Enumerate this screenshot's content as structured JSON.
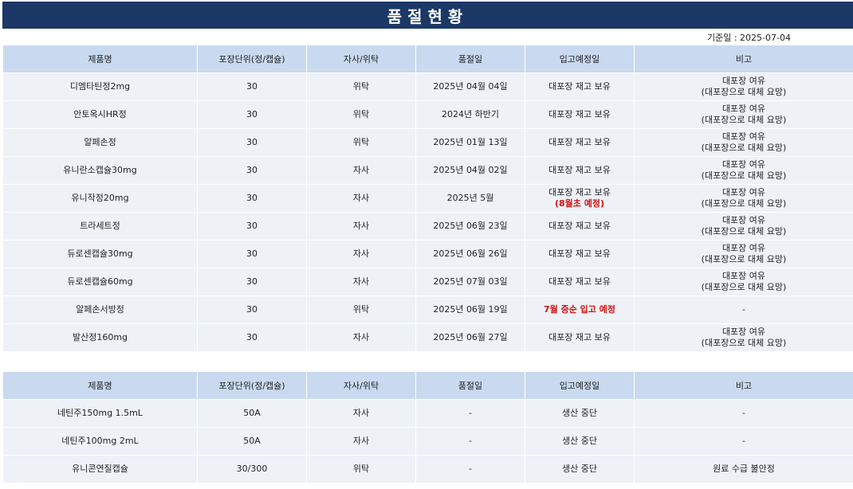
{
  "title": "품절현황",
  "reference_date": "기준일 : 2025-07-04",
  "columns": [
    "제품명",
    "포장단위(정/캡슐)",
    "자사/위탁",
    "품절일",
    "입고예정일",
    "비고"
  ],
  "table1": [
    {
      "name": "디엠타틴정2mg",
      "unit": "30",
      "type": "위탁",
      "date": "2025년 04월 04일",
      "expected": "대포장 재고 보유",
      "expected_note": "",
      "note1": "대포장 여유",
      "note2": "(대포장으로 대체 요망)"
    },
    {
      "name": "안토옥시HR정",
      "unit": "30",
      "type": "위탁",
      "date": "2024년 하반기",
      "expected": "대포장 재고 보유",
      "expected_note": "",
      "note1": "대포장 여유",
      "note2": "(대포장으로 대체 요망)"
    },
    {
      "name": "알페손정",
      "unit": "30",
      "type": "위탁",
      "date": "2025년 01월 13일",
      "expected": "대포장 재고 보유",
      "expected_note": "",
      "note1": "대포장 여유",
      "note2": "(대포장으로 대체 요망)"
    },
    {
      "name": "유니란소캡슐30mg",
      "unit": "30",
      "type": "자사",
      "date": "2025년 04월 02일",
      "expected": "대포장 재고 보유",
      "expected_note": "",
      "note1": "대포장 여유",
      "note2": "(대포장으로 대체 요망)"
    },
    {
      "name": "유니작정20mg",
      "unit": "30",
      "type": "자사",
      "date": "2025년 5월",
      "expected": "대포장 재고 보유",
      "expected_note": "(8월초 예정)",
      "note1": "대포장 여유",
      "note2": "(대포장으로 대체 요망)"
    },
    {
      "name": "트라세트정",
      "unit": "30",
      "type": "자사",
      "date": "2025년 06월 23일",
      "expected": "대포장 재고 보유",
      "expected_note": "",
      "note1": "대포장 여유",
      "note2": "(대포장으로 대체 요망)"
    },
    {
      "name": "듀로센캡슐30mg",
      "unit": "30",
      "type": "자사",
      "date": "2025년 06월 26일",
      "expected": "대포장 재고 보유",
      "expected_note": "",
      "note1": "대포장 여유",
      "note2": "(대포장으로 대체 요망)"
    },
    {
      "name": "듀로센캡슐60mg",
      "unit": "30",
      "type": "자사",
      "date": "2025년 07월 03일",
      "expected": "대포장 재고 보유",
      "expected_note": "",
      "note1": "대포장 여유",
      "note2": "(대포장으로 대체 요망)"
    },
    {
      "name": "알페손서방정",
      "unit": "30",
      "type": "위탁",
      "date": "2025년 06월 19일",
      "expected": "7월 중순 입고 예정",
      "expected_red": true,
      "expected_note": "",
      "note1": "-",
      "note2": ""
    },
    {
      "name": "발산정160mg",
      "unit": "30",
      "type": "자사",
      "date": "2025년 06월 27일",
      "expected": "대포장 재고 보유",
      "expected_note": "",
      "note1": "대포장 여유",
      "note2": "(대포장으로 대체 요망)"
    }
  ],
  "table2": [
    {
      "name": "네틴주150mg 1.5mL",
      "unit": "50A",
      "type": "자사",
      "date": "-",
      "expected": "생산 중단",
      "note": "-"
    },
    {
      "name": "네틴주100mg 2mL",
      "unit": "50A",
      "type": "자사",
      "date": "-",
      "expected": "생산 중단",
      "note": "-"
    },
    {
      "name": "유니콘연질캡슐",
      "unit": "30/300",
      "type": "위탁",
      "date": "-",
      "expected": "생산 중단",
      "note": "원료 수급 불안정"
    }
  ],
  "colors": {
    "title_bg": "#1b3866",
    "header_bg": "#c9daf0",
    "row_bg": "#eef2f7",
    "alert": "#d11414"
  }
}
